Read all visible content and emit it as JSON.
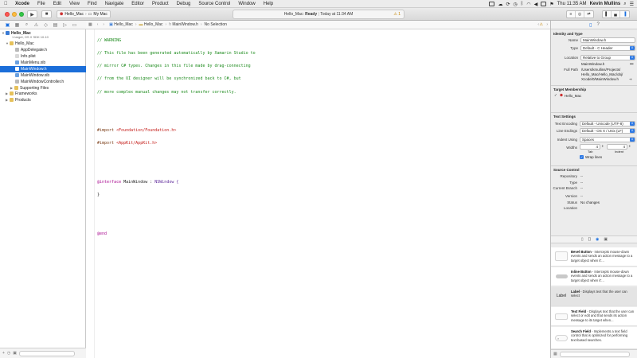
{
  "menubar": {
    "apple": "",
    "items": [
      "Xcode",
      "File",
      "Edit",
      "View",
      "Find",
      "Navigate",
      "Editor",
      "Product",
      "Debug",
      "Source Control",
      "Window",
      "Help"
    ],
    "clock": "Thu 11:35 AM",
    "user": "Kevin Mullins"
  },
  "toolbar": {
    "scheme": "Hello_Mac",
    "destination": "My Mac",
    "activity_project": "Hello_Mac:",
    "activity_status": "Ready",
    "activity_time": "Today at 11:34 AM",
    "warning_count": "1"
  },
  "navigator": {
    "project": "Hello_Mac",
    "project_sub": "1 target, OS X SDK 10.10",
    "group": "Hello_Mac",
    "files": [
      "AppDelegate.h",
      "Info.plist",
      "MainMenu.xib",
      "MainWindow.h",
      "MainWindow.xib",
      "MainWindowController.h"
    ],
    "folders": [
      "Supporting Files",
      "Frameworks",
      "Products"
    ]
  },
  "jumpbar": {
    "project": "Hello_Mac",
    "group": "Hello_Mac",
    "file": "MainWindow.h",
    "symbol": "No Selection"
  },
  "code": {
    "l1": "// WARNING",
    "l2": "// This file has been generated automatically by Xamarin Studio to",
    "l3": "// mirror C# types. Changes in this file made by drag-connecting",
    "l4": "// from the UI designer will be synchronized back to C#, but",
    "l5": "// more complex manual changes may not transfer correctly.",
    "imp_kw": "#import",
    "imp1": "<Foundation/Foundation.h>",
    "imp2": "<AppKit/AppKit.h>",
    "iface_kw": "@interface",
    "iface_name": "MainWindow :",
    "iface_super": "NSWindow {",
    "brace": "}",
    "end_kw": "@end"
  },
  "inspector": {
    "identity_title": "Identity and Type",
    "name_label": "Name",
    "name_value": "MainWindow.h",
    "type_label": "Type",
    "type_value": "Default - C Header",
    "location_label": "Location",
    "location_value": "Relative to Group",
    "location_file": "MainWindow.h",
    "fullpath_label": "Full Path",
    "fullpath_value": [
      "/Users/kmullins/Projects/",
      "Hello_Mac/Hello_Mac/obj/",
      "Xcode/0/MainWindow.h"
    ],
    "target_title": "Target Membership",
    "target_name": "Hello_Mac",
    "text_title": "Text Settings",
    "encoding_label": "Text Encoding",
    "encoding_value": "Default - Unicode (UTF-8)",
    "endings_label": "Line Endings",
    "endings_value": "Default - OS X / Unix (LF)",
    "indent_label": "Indent Using",
    "indent_value": "Spaces",
    "widths_label": "Widths",
    "tab_value": "4",
    "indent_num": "4",
    "tab_label": "Tab",
    "indent_sub": "Indent",
    "wrap_label": "Wrap lines",
    "sc_title": "Source Control",
    "repo_label": "Repository",
    "repo_value": "--",
    "sctype_label": "Type",
    "sctype_value": "--",
    "branch_label": "Current Branch",
    "branch_value": "--",
    "version_label": "Version",
    "version_value": "--",
    "status_label": "Status",
    "status_value": "No changes",
    "scloc_label": "Location",
    "scloc_value": ""
  },
  "library": [
    {
      "title": "Bevel Button",
      "desc": " - Intercepts mouse-down events and sends an action message to a target object when it'..."
    },
    {
      "title": "Inline Button",
      "desc": " - Intercepts mouse-down events and sends an action message to a target object when it'..."
    },
    {
      "title": "Label",
      "desc": " - Displays text that the user can select",
      "thumb": "Label"
    },
    {
      "title": "Text Field",
      "desc": " - Displays text that the user can select or edit and that sends its action message to its target when..."
    },
    {
      "title": "Search Field",
      "desc": " - Implements a text field control that is optimized for performing text-based searches."
    }
  ]
}
